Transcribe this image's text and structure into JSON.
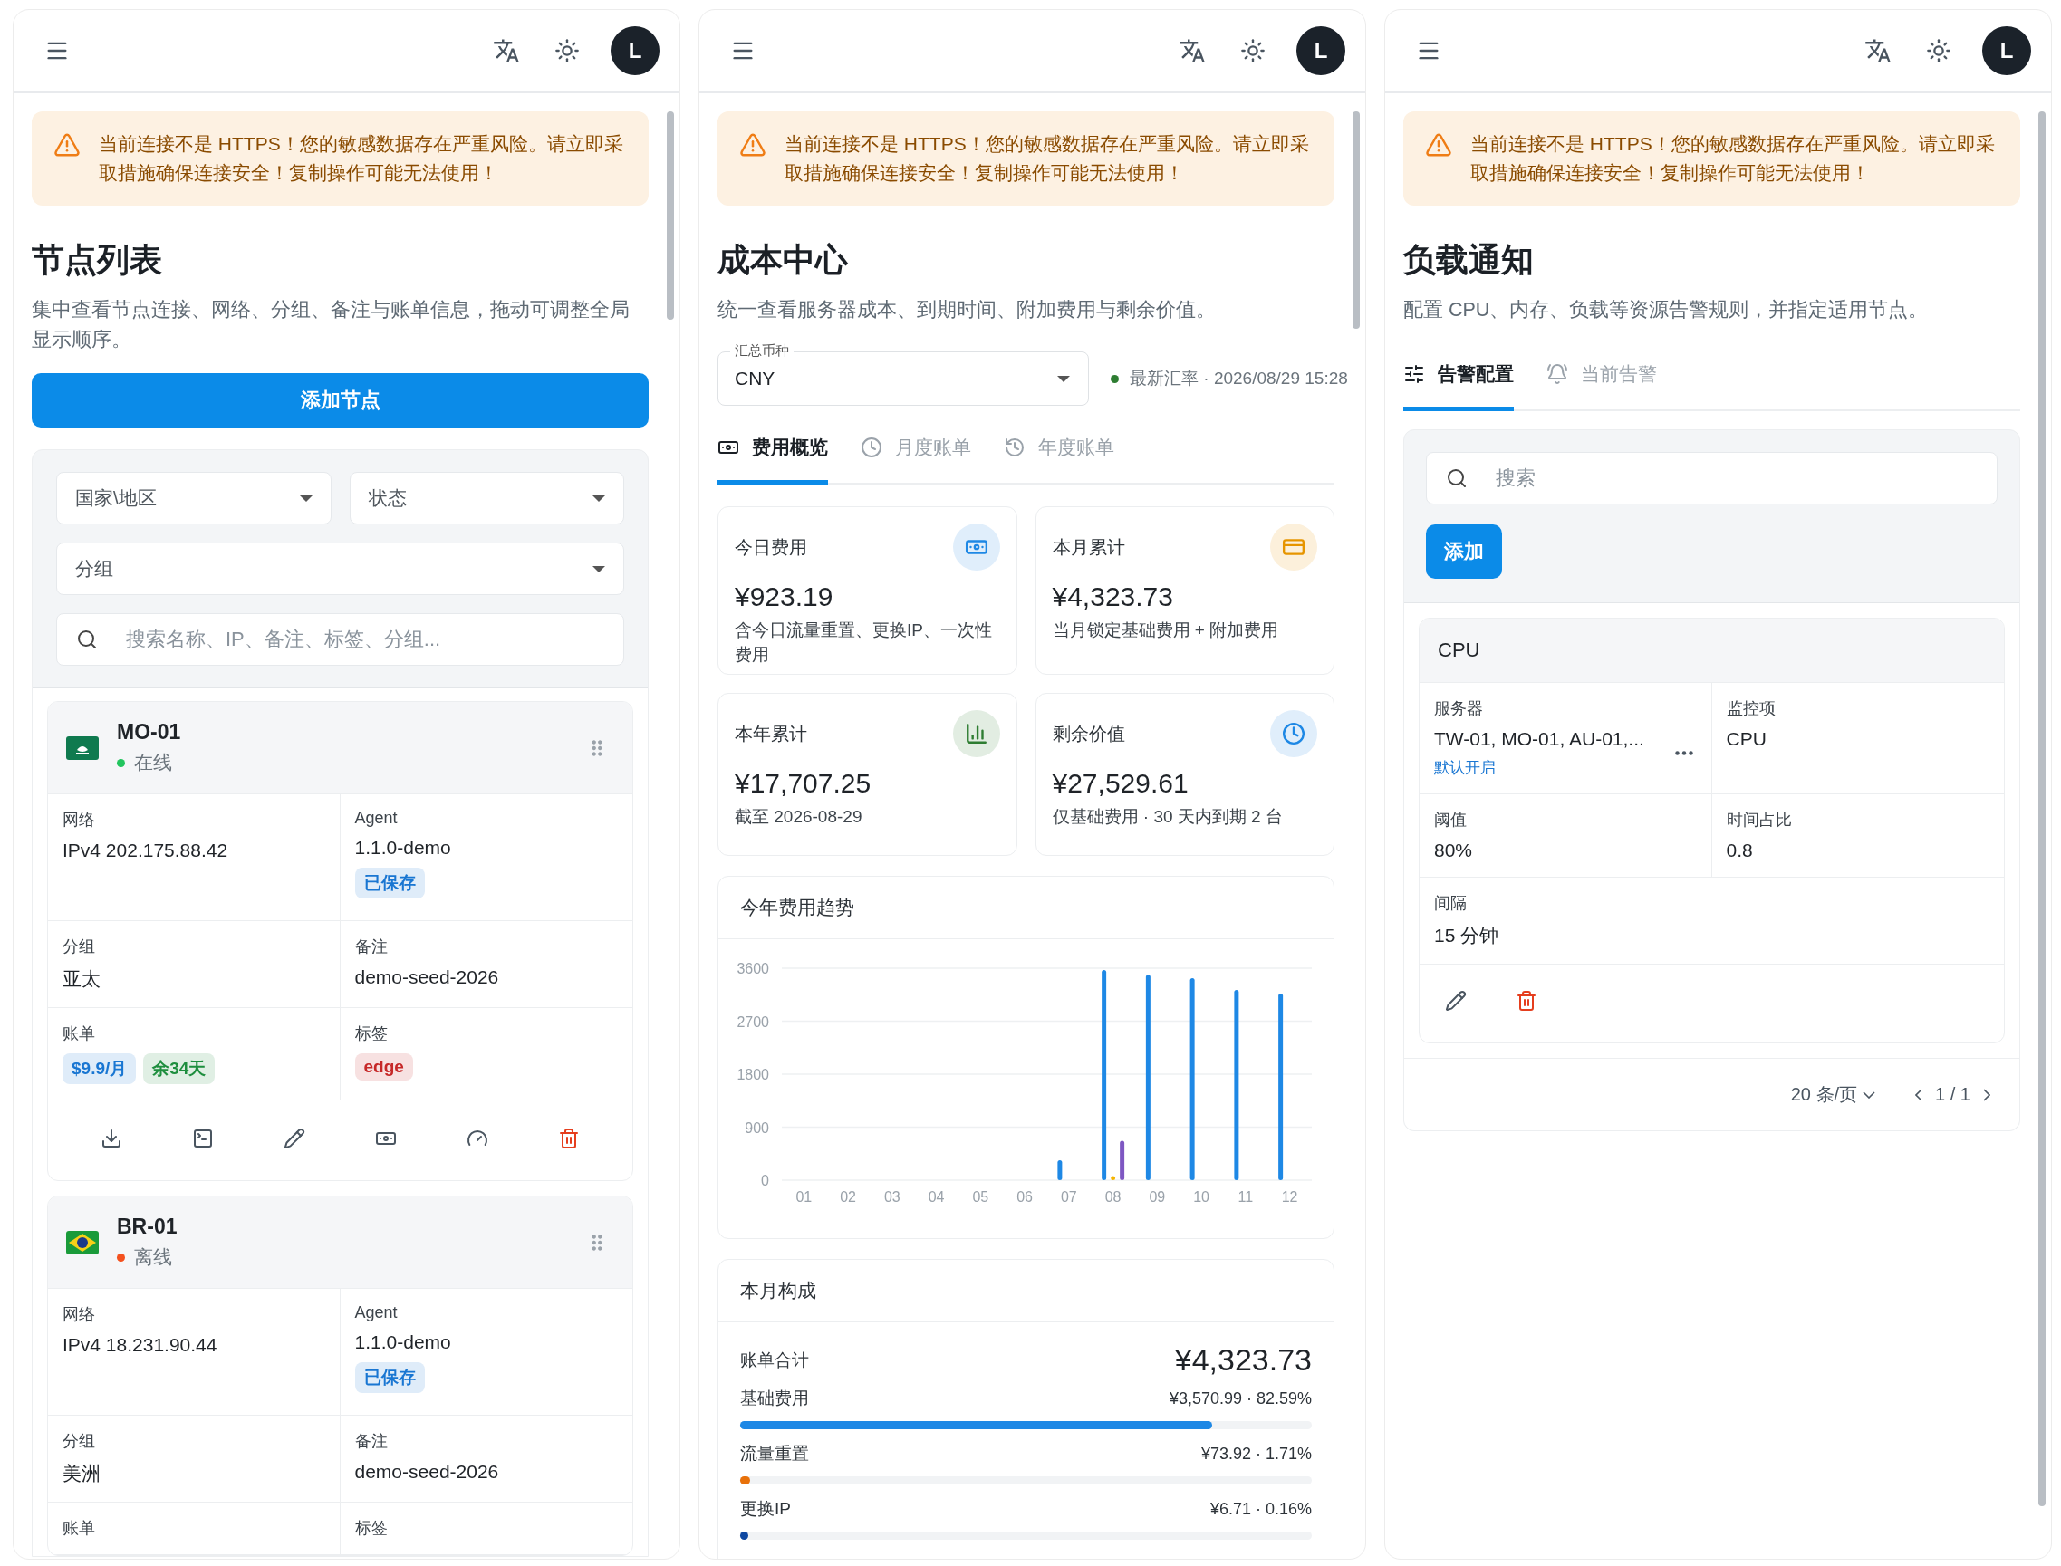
{
  "node_list": {
    "top_bar": {
      "avatar": "L"
    },
    "warning": "当前连接不是 HTTPS！您的敏感数据存在严重风险。请立即采取措施确保连接安全！复制操作可能无法使用！",
    "title": "节点列表",
    "description": "集中查看节点连接、网络、分组、备注与账单信息，拖动可调整全局显示顺序。",
    "add_button": "添加节点",
    "filters": [
      {
        "label": "国家\\地区"
      },
      {
        "label": "状态"
      },
      {
        "label": "分组"
      }
    ],
    "search": {
      "placeholder": "搜索名称、IP、备注、标签、分组..."
    },
    "nodes": [
      {
        "name": "MO-01",
        "kind": "macau",
        "status": "在线",
        "color": "#22c55e",
        "cells": [
          {
            "label": "网络",
            "value": "IPv4 202.175.88.42"
          },
          {
            "label": "Agent",
            "value": "1.1.0-demo",
            "badges": [
              {
                "text": "已保存",
                "color": "#1976d2"
              }
            ]
          },
          {
            "label": "分组",
            "value": "亚太"
          },
          {
            "label": "备注",
            "value": "demo-seed-2026"
          },
          {
            "label": "账单",
            "badges": [
              {
                "text": "$9.9/月",
                "color": "#1976d2"
              },
              {
                "text": "余34天",
                "color": "#1e8e3e"
              }
            ]
          },
          {
            "label": "标签",
            "badges": [
              {
                "text": "edge",
                "color": "#c62828"
              }
            ]
          }
        ]
      },
      {
        "name": "BR-01",
        "kind": "brazil",
        "status": "离线",
        "color": "#f4511e",
        "cells": [
          {
            "label": "网络",
            "value": "IPv4 18.231.90.44"
          },
          {
            "label": "Agent",
            "value": "1.1.0-demo",
            "badges": [
              {
                "text": "已保存",
                "color": "#1976d2"
              }
            ]
          },
          {
            "label": "分组",
            "value": "美洲"
          },
          {
            "label": "备注",
            "value": "demo-seed-2026"
          },
          {
            "label": "账单"
          },
          {
            "label": "标签"
          }
        ]
      }
    ]
  },
  "cost_center": {
    "top_bar": {
      "avatar": "L"
    },
    "warning": "当前连接不是 HTTPS！您的敏感数据存在严重风险。请立即采取措施确保连接安全！复制操作可能无法使用！",
    "title": "成本中心",
    "description": "统一查看服务器成本、到期时间、附加费用与剩余价值。",
    "currency": {
      "label": "汇总币种",
      "value": "CNY"
    },
    "rate": {
      "text": "最新汇率 · 2026/08/29 15:28",
      "color": "#2e7d32"
    },
    "tabs": [
      {
        "label": "费用概览",
        "selected": true
      },
      {
        "label": "月度账单",
        "selected": false
      },
      {
        "label": "年度账单",
        "selected": false
      }
    ],
    "stats": [
      {
        "title": "今日费用",
        "value": "¥923.19",
        "note": "含今日流量重置、更换IP、一次性费用",
        "color": "#1e88e5"
      },
      {
        "title": "本月累计",
        "value": "¥4,323.73",
        "note": "当月锁定基础费用 + 附加费用",
        "color": "#e69500"
      },
      {
        "title": "本年累计",
        "value": "¥17,707.25",
        "note": "截至 2026-08-29",
        "color": "#2e7d32"
      },
      {
        "title": "剩余价值",
        "value": "¥27,529.61",
        "note": "仅基础费用 · 30 天内到期 2 台",
        "color": "#1e88e5"
      }
    ],
    "trend": {
      "chart_data": {
        "type": "bar",
        "title": "今年费用趋势",
        "categories": [
          "01",
          "02",
          "03",
          "04",
          "05",
          "06",
          "07",
          "08",
          "09",
          "10",
          "11",
          "12"
        ],
        "ylim": [
          0,
          3600
        ],
        "yticks": [
          0,
          900,
          1800,
          2700,
          3600
        ],
        "grid": true,
        "series": [
          {
            "color": "#1e88e5",
            "values": [
              0,
              0,
              0,
              0,
              0,
              0,
              340,
              3570,
              3490,
              3430,
              3230,
              3170
            ]
          },
          {
            "color": "#f5b400",
            "values": [
              0,
              0,
              0,
              0,
              0,
              0,
              0,
              70,
              0,
              0,
              0,
              0
            ]
          },
          {
            "color": "#7e57c2",
            "values": [
              0,
              0,
              0,
              0,
              0,
              0,
              0,
              670,
              0,
              0,
              0,
              0
            ]
          }
        ]
      }
    },
    "composition": {
      "title": "本月构成",
      "total_label": "账单合计",
      "total": "¥4,323.73",
      "items": [
        {
          "label": "基础费用",
          "amount": "¥3,570.99 · 82.59%",
          "level": 0.8259,
          "color": "#1e88e5"
        },
        {
          "label": "流量重置",
          "amount": "¥73.92 · 1.71%",
          "level": 0.0171,
          "color": "#e8710a"
        },
        {
          "label": "更换IP",
          "amount": "¥6.71 · 0.16%",
          "level": 0.0016,
          "color": "#0d47a1"
        }
      ]
    }
  },
  "load_alerts": {
    "top_bar": {
      "avatar": "L"
    },
    "warning": "当前连接不是 HTTPS！您的敏感数据存在严重风险。请立即采取措施确保连接安全！复制操作可能无法使用！",
    "title": "负载通知",
    "description": "配置 CPU、内存、负载等资源告警规则，并指定适用节点。",
    "tabs": [
      {
        "label": "告警配置",
        "selected": true
      },
      {
        "label": "当前告警",
        "selected": false
      }
    ],
    "search": {
      "placeholder": "搜索"
    },
    "add_button": "添加",
    "rule": {
      "title": "CPU",
      "cells": [
        {
          "label": "服务器",
          "value": "TW-01, MO-01, AU-01,...",
          "link": "默认开启"
        },
        {
          "label": "监控项",
          "value": "CPU"
        },
        {
          "label": "阈值",
          "value": "80%"
        },
        {
          "label": "时间占比",
          "value": "0.8"
        },
        {
          "label": "间隔",
          "value": "15 分钟"
        }
      ]
    },
    "pagination": {
      "page_size": "20 条/页",
      "page": "1 / 1"
    }
  }
}
